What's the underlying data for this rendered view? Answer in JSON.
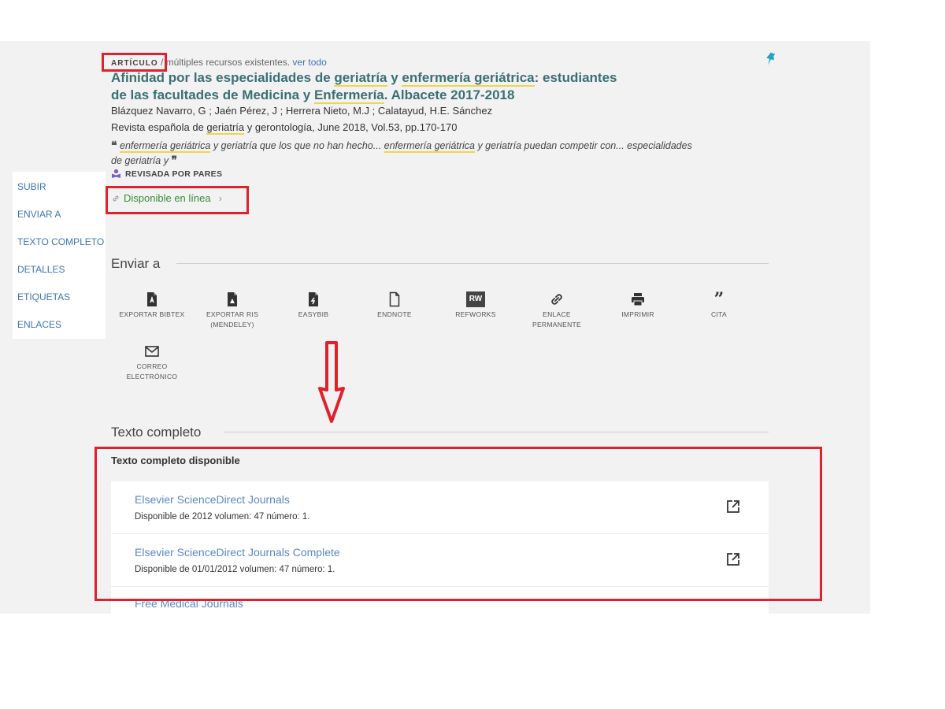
{
  "record": {
    "type_label": "ARTÍCULO",
    "resources_text": "/ múltiples recursos existentes.",
    "view_all": "ver todo",
    "title_parts": [
      "Afinidad por las especialidades de ",
      "geriatría",
      " y ",
      "enfermería geriátrica",
      ": estudiantes de las facultades de Medicina y ",
      "Enfermería",
      ". Albacete 2017-2018"
    ],
    "authors": "Blázquez Navarro, G ; Jaén Pérez, J ; Herrera Nieto, M.J ; Calatayud, H.E. Sánchez",
    "source_parts": [
      "Revista española de ",
      "geriatría",
      " y gerontología, June 2018, Vol.53, pp.170-170"
    ],
    "snippet_parts": [
      "enfermería geriátrica",
      " y geriatría que los que no han hecho... ",
      "enfermería geriátrica",
      " y geriatría puedan competir con... especialidades de geriatría y"
    ],
    "peer_reviewed": "REVISADA POR PARES",
    "availability": "Disponible en línea"
  },
  "side_nav": [
    "SUBIR",
    "ENVIAR A",
    "TEXTO COMPLETO",
    "DETALLES",
    "ETIQUETAS",
    "ENLACES"
  ],
  "send_to": {
    "title": "Enviar a",
    "actions": [
      {
        "label": "EXPORTAR BIBTEX",
        "icon": "bibtex-icon"
      },
      {
        "label": "EXPORTAR RIS (MENDELEY)",
        "icon": "ris-icon"
      },
      {
        "label": "EASYBIB",
        "icon": "easybib-icon"
      },
      {
        "label": "ENDNOTE",
        "icon": "endnote-icon"
      },
      {
        "label": "REFWORKS",
        "icon": "refworks-icon"
      },
      {
        "label": "ENLACE PERMANENTE",
        "icon": "link-icon"
      },
      {
        "label": "IMPRIMIR",
        "icon": "print-icon"
      },
      {
        "label": "CITA",
        "icon": "quote-icon"
      },
      {
        "label": "CORREO ELECTRÓNICO",
        "icon": "mail-icon"
      }
    ],
    "refworks_badge": "RW"
  },
  "full_text": {
    "title": "Texto completo",
    "available_label": "Texto completo disponible",
    "services": [
      {
        "name": "Elsevier ScienceDirect Journals",
        "coverage": "Disponible de 2012 volumen: 47 número: 1."
      },
      {
        "name": "Elsevier ScienceDirect Journals Complete",
        "coverage": "Disponible de 01/01/2012 volumen: 47 número: 1."
      },
      {
        "name": "Free Medical Journals",
        "coverage": ""
      }
    ]
  },
  "colors": {
    "annotation_red": "#e0202a",
    "link_blue": "#3f74b5",
    "title_teal": "#3b6f74",
    "available_green": "#3a8b3a",
    "highlight_yellow": "#f2d447"
  }
}
